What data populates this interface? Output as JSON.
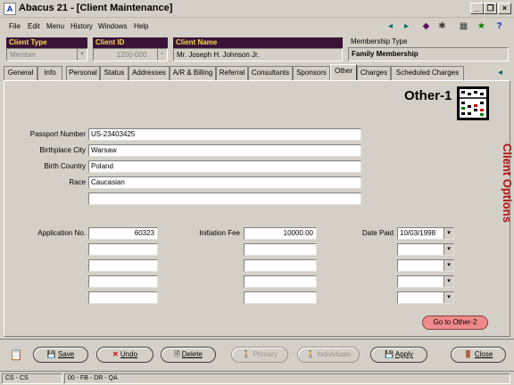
{
  "window": {
    "title": "Abacus 21 - [Client Maintenance]",
    "app_icon_glyph": "A",
    "controls": {
      "minimize": "_",
      "restore": "❐",
      "close": "×"
    }
  },
  "menu": [
    "File",
    "Edit",
    "Menu",
    "History",
    "Windows",
    "Help"
  ],
  "toolbar_icons": [
    "arrow-left-icon",
    "arrow-right-icon",
    "book-icon",
    "gear-icon",
    "calculator-icon",
    "runner-icon",
    "help-icon"
  ],
  "header": {
    "client_type_label": "Client Type",
    "client_type_value": "Member",
    "client_id_label": "Client ID",
    "client_id_value": "1200-000",
    "client_name_label": "Client Name",
    "client_name_value": "Mr. Joseph H. Johnson Jr.",
    "membership_type_label": "Membership Type",
    "membership_type_value": "Family Membership"
  },
  "tabs": [
    "General",
    "Info",
    "Personal",
    "Status",
    "Addresses",
    "A/R & Billing",
    "Referral",
    "Consultants",
    "Sponsors",
    "Other",
    "Charges",
    "Scheduled Charges"
  ],
  "active_tab": "Other",
  "panel": {
    "heading": "Other-1",
    "side_label": "Client Options",
    "go_button": "Go to Other-2"
  },
  "fields": {
    "passport_label": "Passport Number",
    "passport_value": "US-23403425",
    "birthplace_label": "Birthplace City",
    "birthplace_value": "Warsaw",
    "birth_country_label": "Birth Country",
    "birth_country_value": "Poland",
    "race_label": "Race",
    "race_value": "Caucasian",
    "application_label": "Application No.",
    "application_value": "60323",
    "initiation_label": "Initiation Fee",
    "initiation_value": "10000.00",
    "date_paid_label": "Date Paid",
    "date_paid_value": "10/03/1998"
  },
  "buttons": {
    "save": "Save",
    "undo": "Undo",
    "delete": "Delete",
    "primary": "Primary",
    "individuals": "Individuals",
    "apply": "Apply",
    "close": "Close"
  },
  "status": {
    "left": "CS - CS",
    "right": "00 - FB - DR - QA"
  },
  "colors": {
    "header_label_bg": "#3a1438",
    "header_label_fg": "#ffd84a",
    "side_label": "#b01010",
    "go_button_bg": "#f08a8a"
  }
}
